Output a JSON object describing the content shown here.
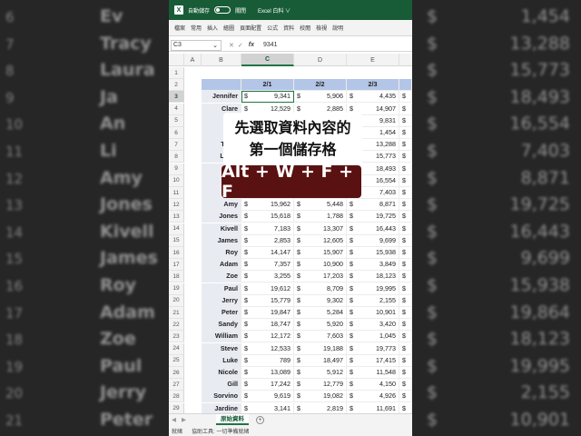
{
  "background": {
    "rows": [
      {
        "n": "6",
        "name": "Ev",
        "val": "1,454"
      },
      {
        "n": "7",
        "name": "Tracy",
        "val": "13,288"
      },
      {
        "n": "8",
        "name": "Laura",
        "val": "15,773"
      },
      {
        "n": "9",
        "name": "Ja",
        "val": "18,493"
      },
      {
        "n": "10",
        "name": "An",
        "val": "16,554"
      },
      {
        "n": "11",
        "name": "Li",
        "val": "7,403"
      },
      {
        "n": "12",
        "name": "Amy",
        "val": "8,871"
      },
      {
        "n": "13",
        "name": "Jones",
        "val": "19,725"
      },
      {
        "n": "14",
        "name": "Kivell",
        "val": "16,443"
      },
      {
        "n": "15",
        "name": "James",
        "val": "9,699"
      },
      {
        "n": "16",
        "name": "Roy",
        "val": "15,938"
      },
      {
        "n": "17",
        "name": "Adam",
        "val": "19,864"
      },
      {
        "n": "18",
        "name": "Zoe",
        "val": "18,123"
      },
      {
        "n": "19",
        "name": "Paul",
        "val": "19,995"
      },
      {
        "n": "20",
        "name": "Jerry",
        "val": "2,155"
      },
      {
        "n": "21",
        "name": "Peter",
        "val": "10,901"
      }
    ],
    "currency": "$"
  },
  "titlebar": {
    "autosave": "自動儲存",
    "toggle": "關閉",
    "app": "Excel 白料 ∨"
  },
  "ribbon": {
    "tabs": [
      "檔案",
      "常用",
      "插入",
      "繪圖",
      "頁面配置",
      "公式",
      "資料",
      "校閱",
      "檢視",
      "說明"
    ]
  },
  "formula_bar": {
    "cell_ref": "C3",
    "fx": "fx",
    "value": "9341",
    "cancel": "✕",
    "confirm": "✓"
  },
  "columns": [
    "",
    "A",
    "B",
    "C",
    "D",
    "E"
  ],
  "header_row": {
    "dates": [
      "2/1",
      "2/2",
      "2/3"
    ]
  },
  "currency": "$",
  "rows": [
    {
      "name": "Jennifer",
      "c": "9,341",
      "d": "5,906",
      "e": "4,435"
    },
    {
      "name": "Clare",
      "c": "12,529",
      "d": "2,885",
      "e": "14,907"
    },
    {
      "name": "Tor",
      "c": "",
      "d": "",
      "e": "9,831"
    },
    {
      "name": "Ev",
      "c": "",
      "d": "",
      "e": "1,454"
    },
    {
      "name": "Tracy",
      "c": "",
      "d": "",
      "e": "13,288"
    },
    {
      "name": "Laura",
      "c": "",
      "d": "",
      "e": "15,773"
    },
    {
      "name": "Ja",
      "c": "13,720",
      "d": "",
      "e": "18,493"
    },
    {
      "name": "An",
      "c": "",
      "d": "",
      "e": "16,554"
    },
    {
      "name": "Li",
      "c": "",
      "d": "",
      "e": "7,403"
    },
    {
      "name": "Amy",
      "c": "15,962",
      "d": "5,448",
      "e": "8,871"
    },
    {
      "name": "Jones",
      "c": "15,618",
      "d": "1,788",
      "e": "19,725"
    },
    {
      "name": "Kivell",
      "c": "7,183",
      "d": "13,307",
      "e": "16,443"
    },
    {
      "name": "James",
      "c": "2,853",
      "d": "12,605",
      "e": "9,699"
    },
    {
      "name": "Roy",
      "c": "14,147",
      "d": "15,907",
      "e": "15,938"
    },
    {
      "name": "Adam",
      "c": "7,357",
      "d": "10,900",
      "e": "3,849"
    },
    {
      "name": "Zoe",
      "c": "3,255",
      "d": "17,203",
      "e": "18,123"
    },
    {
      "name": "Paul",
      "c": "19,612",
      "d": "8,709",
      "e": "19,995"
    },
    {
      "name": "Jerry",
      "c": "15,779",
      "d": "9,302",
      "e": "2,155"
    },
    {
      "name": "Peter",
      "c": "19,847",
      "d": "5,284",
      "e": "10,901"
    },
    {
      "name": "Sandy",
      "c": "18,747",
      "d": "5,920",
      "e": "3,420"
    },
    {
      "name": "William",
      "c": "12,172",
      "d": "7,603",
      "e": "1,045"
    },
    {
      "name": "Steve",
      "c": "12,533",
      "d": "19,188",
      "e": "19,773"
    },
    {
      "name": "Luke",
      "c": "789",
      "d": "18,497",
      "e": "17,415"
    },
    {
      "name": "Nicole",
      "c": "13,089",
      "d": "5,912",
      "e": "11,548"
    },
    {
      "name": "Gill",
      "c": "17,242",
      "d": "12,779",
      "e": "4,150"
    },
    {
      "name": "Sorvino",
      "c": "9,619",
      "d": "19,082",
      "e": "4,926"
    },
    {
      "name": "Jardine",
      "c": "3,141",
      "d": "2,819",
      "e": "11,691"
    },
    {
      "name": "Andrews",
      "c": "14,205",
      "d": "11,811",
      "e": "18,068"
    },
    {
      "name": "Thompson",
      "c": "5,126",
      "d": "15,383",
      "e": "1,003"
    }
  ],
  "sheet_tab": "原始資料",
  "status": {
    "ready": "就緒",
    "access": "協助工具: 一切準備就緒"
  },
  "overlay": {
    "line1": "先選取資料內容的",
    "line2": "第一個儲存格",
    "shortcut": "Alt + W + F + F"
  }
}
